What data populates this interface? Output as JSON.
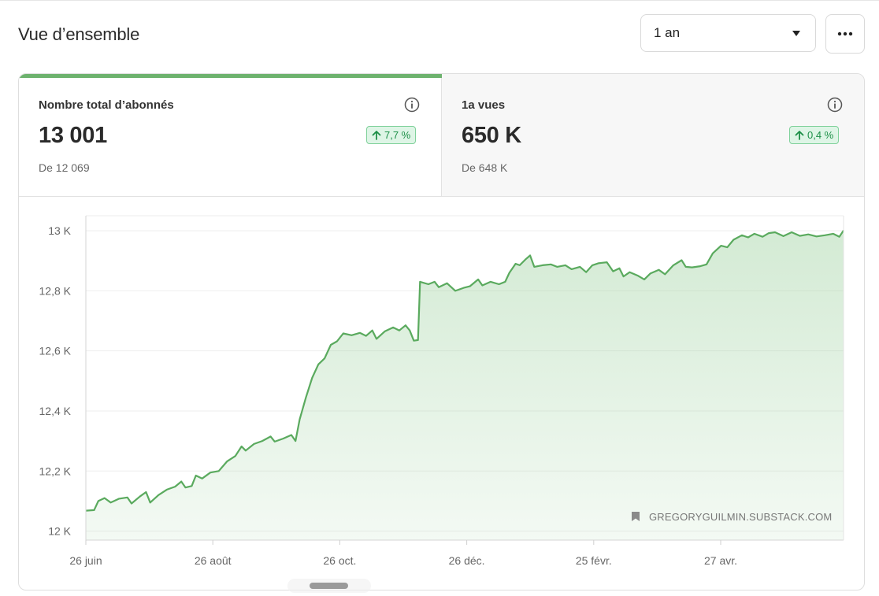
{
  "page": {
    "title": "Vue d’ensemble"
  },
  "controls": {
    "range_value": "1 an",
    "range_options": [
      "1 an"
    ],
    "more_icon": "ellipsis-icon"
  },
  "metrics": [
    {
      "label": "Nombre total d’abonnés",
      "value": "13 001",
      "change": "7,7 %",
      "change_direction": "up",
      "previous": "De 12 069",
      "info_icon": "info-icon",
      "selected": true
    },
    {
      "label": "1a vues",
      "value": "650 K",
      "change": "0,4 %",
      "change_direction": "up",
      "previous": "De 648 K",
      "info_icon": "info-icon",
      "selected": false
    }
  ],
  "colors": {
    "accent": "#6db26e",
    "badge_bg": "#def5e6",
    "badge_text": "#1c8f47",
    "line": "#5aaa5e"
  },
  "watermark": {
    "icon": "bookmark-icon",
    "text": "GREGORYGUILMIN.SUBSTACK.COM"
  },
  "chart_data": {
    "type": "area",
    "title": "",
    "xlabel": "",
    "ylabel": "",
    "x_ticks": [
      "26 juin",
      "26 août",
      "26 oct.",
      "26 déc.",
      "25 févr.",
      "27 avr."
    ],
    "y_ticks": [
      "12 K",
      "12,2 K",
      "12,4 K",
      "12,6 K",
      "12,8 K",
      "13 K"
    ],
    "y_tick_values": [
      12000,
      12200,
      12400,
      12600,
      12800,
      13000
    ],
    "ylim": [
      11970,
      13050
    ],
    "x_range": [
      "2024-06-26",
      "2025-06-26"
    ],
    "grid": "horizontal",
    "legend": "none",
    "series": [
      {
        "values": [
          [
            "2024-06-26",
            12068
          ],
          [
            "2024-06-30",
            12070
          ],
          [
            "2024-07-02",
            12100
          ],
          [
            "2024-07-05",
            12110
          ],
          [
            "2024-07-08",
            12095
          ],
          [
            "2024-07-12",
            12108
          ],
          [
            "2024-07-16",
            12112
          ],
          [
            "2024-07-18",
            12092
          ],
          [
            "2024-07-22",
            12115
          ],
          [
            "2024-07-25",
            12130
          ],
          [
            "2024-07-27",
            12095
          ],
          [
            "2024-07-31",
            12120
          ],
          [
            "2024-08-04",
            12138
          ],
          [
            "2024-08-08",
            12148
          ],
          [
            "2024-08-11",
            12165
          ],
          [
            "2024-08-13",
            12145
          ],
          [
            "2024-08-16",
            12150
          ],
          [
            "2024-08-18",
            12185
          ],
          [
            "2024-08-21",
            12175
          ],
          [
            "2024-08-25",
            12195
          ],
          [
            "2024-08-29",
            12200
          ],
          [
            "2024-09-02",
            12232
          ],
          [
            "2024-09-06",
            12250
          ],
          [
            "2024-09-09",
            12282
          ],
          [
            "2024-09-11",
            12268
          ],
          [
            "2024-09-15",
            12290
          ],
          [
            "2024-09-19",
            12300
          ],
          [
            "2024-09-23",
            12315
          ],
          [
            "2024-09-25",
            12298
          ],
          [
            "2024-09-29",
            12308
          ],
          [
            "2024-10-03",
            12320
          ],
          [
            "2024-10-05",
            12300
          ],
          [
            "2024-10-07",
            12372
          ],
          [
            "2024-10-10",
            12445
          ],
          [
            "2024-10-13",
            12510
          ],
          [
            "2024-10-16",
            12555
          ],
          [
            "2024-10-19",
            12575
          ],
          [
            "2024-10-22",
            12620
          ],
          [
            "2024-10-25",
            12632
          ],
          [
            "2024-10-28",
            12658
          ],
          [
            "2024-11-01",
            12652
          ],
          [
            "2024-11-05",
            12660
          ],
          [
            "2024-11-08",
            12650
          ],
          [
            "2024-11-11",
            12668
          ],
          [
            "2024-11-13",
            12640
          ],
          [
            "2024-11-17",
            12665
          ],
          [
            "2024-11-21",
            12678
          ],
          [
            "2024-11-24",
            12668
          ],
          [
            "2024-11-27",
            12685
          ],
          [
            "2024-11-29",
            12668
          ],
          [
            "2024-12-01",
            12634
          ],
          [
            "2024-12-03",
            12636
          ],
          [
            "2024-12-04",
            12830
          ],
          [
            "2024-12-08",
            12822
          ],
          [
            "2024-12-11",
            12830
          ],
          [
            "2024-12-13",
            12812
          ],
          [
            "2024-12-17",
            12825
          ],
          [
            "2024-12-21",
            12800
          ],
          [
            "2024-12-25",
            12810
          ],
          [
            "2024-12-28",
            12815
          ],
          [
            "2025-01-01",
            12838
          ],
          [
            "2025-01-03",
            12818
          ],
          [
            "2025-01-07",
            12830
          ],
          [
            "2025-01-11",
            12822
          ],
          [
            "2025-01-14",
            12830
          ],
          [
            "2025-01-16",
            12860
          ],
          [
            "2025-01-19",
            12890
          ],
          [
            "2025-01-21",
            12885
          ],
          [
            "2025-01-24",
            12906
          ],
          [
            "2025-01-26",
            12918
          ],
          [
            "2025-01-28",
            12880
          ],
          [
            "2025-02-01",
            12885
          ],
          [
            "2025-02-05",
            12888
          ],
          [
            "2025-02-08",
            12880
          ],
          [
            "2025-02-12",
            12885
          ],
          [
            "2025-02-15",
            12872
          ],
          [
            "2025-02-19",
            12880
          ],
          [
            "2025-02-22",
            12862
          ],
          [
            "2025-02-25",
            12885
          ],
          [
            "2025-02-28",
            12892
          ],
          [
            "2025-03-04",
            12895
          ],
          [
            "2025-03-07",
            12865
          ],
          [
            "2025-03-10",
            12875
          ],
          [
            "2025-03-12",
            12848
          ],
          [
            "2025-03-15",
            12862
          ],
          [
            "2025-03-19",
            12850
          ],
          [
            "2025-03-22",
            12838
          ],
          [
            "2025-03-25",
            12858
          ],
          [
            "2025-03-29",
            12870
          ],
          [
            "2025-04-01",
            12855
          ],
          [
            "2025-04-05",
            12885
          ],
          [
            "2025-04-09",
            12902
          ],
          [
            "2025-04-11",
            12880
          ],
          [
            "2025-04-14",
            12878
          ],
          [
            "2025-04-18",
            12882
          ],
          [
            "2025-04-21",
            12888
          ],
          [
            "2025-04-24",
            12925
          ],
          [
            "2025-04-28",
            12950
          ],
          [
            "2025-05-01",
            12945
          ],
          [
            "2025-05-04",
            12970
          ],
          [
            "2025-05-08",
            12985
          ],
          [
            "2025-05-11",
            12978
          ],
          [
            "2025-05-14",
            12990
          ],
          [
            "2025-05-18",
            12980
          ],
          [
            "2025-05-21",
            12992
          ],
          [
            "2025-05-24",
            12995
          ],
          [
            "2025-05-28",
            12982
          ],
          [
            "2025-06-01",
            12995
          ],
          [
            "2025-06-05",
            12983
          ],
          [
            "2025-06-09",
            12988
          ],
          [
            "2025-06-13",
            12981
          ],
          [
            "2025-06-17",
            12985
          ],
          [
            "2025-06-21",
            12990
          ],
          [
            "2025-06-24",
            12980
          ],
          [
            "2025-06-26",
            13001
          ]
        ]
      }
    ]
  }
}
